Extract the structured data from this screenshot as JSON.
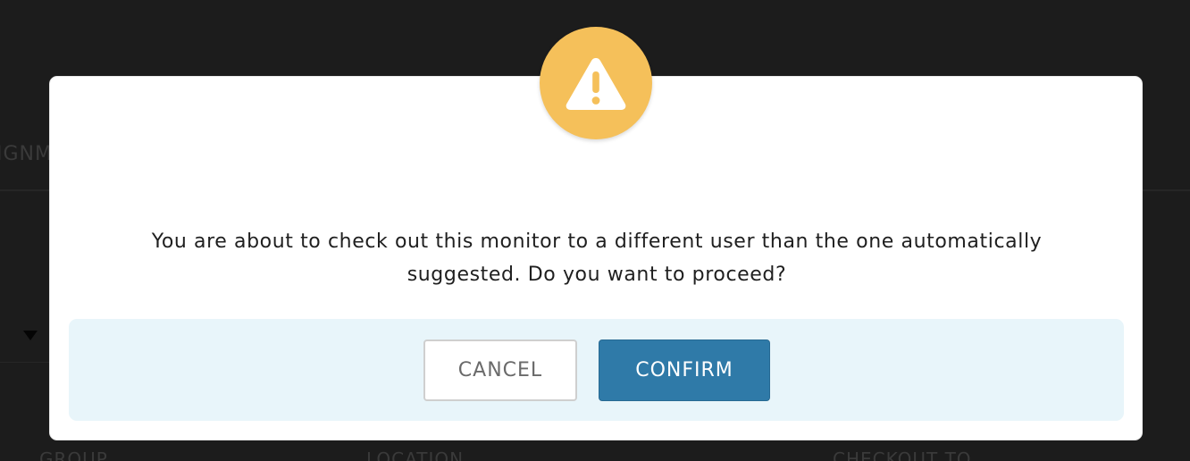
{
  "background": {
    "tab_label": "IGNM",
    "columns": [
      "GROUP",
      "LOCATION",
      "CHECKOUT TO"
    ]
  },
  "modal": {
    "icon": "warning-icon",
    "message": "You are about to check out this monitor to a different user than the one automatically suggested. Do you want to proceed?",
    "cancel_label": "CANCEL",
    "confirm_label": "CONFIRM"
  },
  "colors": {
    "overlay": "#1c1c1c",
    "warning": "#f5c05a",
    "footer_bg": "#e8f5fa",
    "confirm_bg": "#2f7aa8"
  }
}
